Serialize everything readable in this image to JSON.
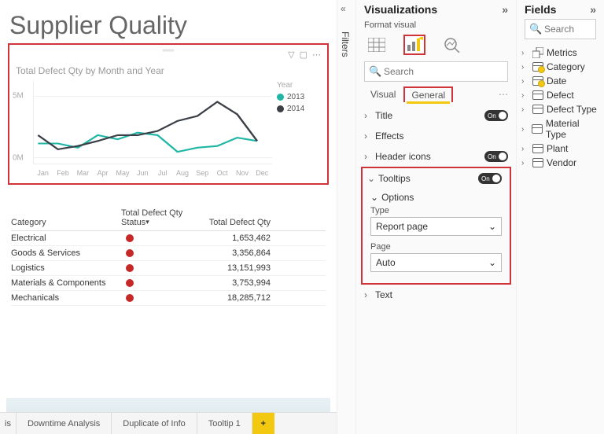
{
  "pageTitle": "Supplier Quality",
  "chart": {
    "title": "Total Defect Qty by Month and Year",
    "legendTitle": "Year",
    "y": {
      "t0": "0M",
      "t1": "5M"
    },
    "months": [
      "Jan",
      "Feb",
      "Mar",
      "Apr",
      "May",
      "Jun",
      "Jul",
      "Aug",
      "Sep",
      "Oct",
      "Nov",
      "Dec"
    ],
    "series": [
      {
        "name": "2013",
        "color": "#1fb6a6"
      },
      {
        "name": "2014",
        "color": "#3b3f46"
      }
    ]
  },
  "chart_data": {
    "type": "line",
    "title": "Total Defect Qty by Month and Year",
    "xlabel": "",
    "ylabel": "Total Defect Qty",
    "ylim": [
      0,
      6000000
    ],
    "categories": [
      "Jan",
      "Feb",
      "Mar",
      "Apr",
      "May",
      "Jun",
      "Jul",
      "Aug",
      "Sep",
      "Oct",
      "Nov",
      "Dec"
    ],
    "series": [
      {
        "name": "2013",
        "values": [
          1400000,
          1400000,
          1000000,
          2200000,
          1800000,
          2400000,
          2200000,
          600000,
          1000000,
          1200000,
          2000000,
          1600000
        ]
      },
      {
        "name": "2014",
        "values": [
          2200000,
          800000,
          1200000,
          1600000,
          2200000,
          2200000,
          2600000,
          3600000,
          4000000,
          5400000,
          4200000,
          1600000
        ]
      }
    ]
  },
  "table": {
    "h1": "Category",
    "h2": "Total Defect Qty Status",
    "h3": "Total Defect Qty",
    "rows": [
      {
        "c": "Electrical",
        "v": "1,653,462"
      },
      {
        "c": "Goods & Services",
        "v": "3,356,864"
      },
      {
        "c": "Logistics",
        "v": "13,151,993"
      },
      {
        "c": "Materials & Components",
        "v": "3,753,994"
      },
      {
        "c": "Mechanicals",
        "v": "18,285,712"
      }
    ]
  },
  "tabs": [
    "is",
    "Downtime Analysis",
    "Duplicate of Info",
    "Tooltip 1"
  ],
  "filtersLabel": "Filters",
  "viz": {
    "title": "Visualizations",
    "sub": "Format visual",
    "searchPlaceholder": "Search",
    "tabVisual": "Visual",
    "tabGeneral": "General",
    "secTitle": "Title",
    "secEffects": "Effects",
    "secHeader": "Header icons",
    "secTooltips": "Tooltips",
    "secOptions": "Options",
    "secText": "Text",
    "typeLabel": "Type",
    "typeValue": "Report page",
    "pageLabel": "Page",
    "pageValue": "Auto",
    "on": "On"
  },
  "fields": {
    "title": "Fields",
    "searchPlaceholder": "Search",
    "items": [
      {
        "n": "Metrics",
        "y": true,
        "m": true
      },
      {
        "n": "Category",
        "y": true
      },
      {
        "n": "Date",
        "y": true
      },
      {
        "n": "Defect",
        "y": false
      },
      {
        "n": "Defect Type",
        "y": false
      },
      {
        "n": "Material Type",
        "y": false
      },
      {
        "n": "Plant",
        "y": false
      },
      {
        "n": "Vendor",
        "y": false
      }
    ]
  }
}
